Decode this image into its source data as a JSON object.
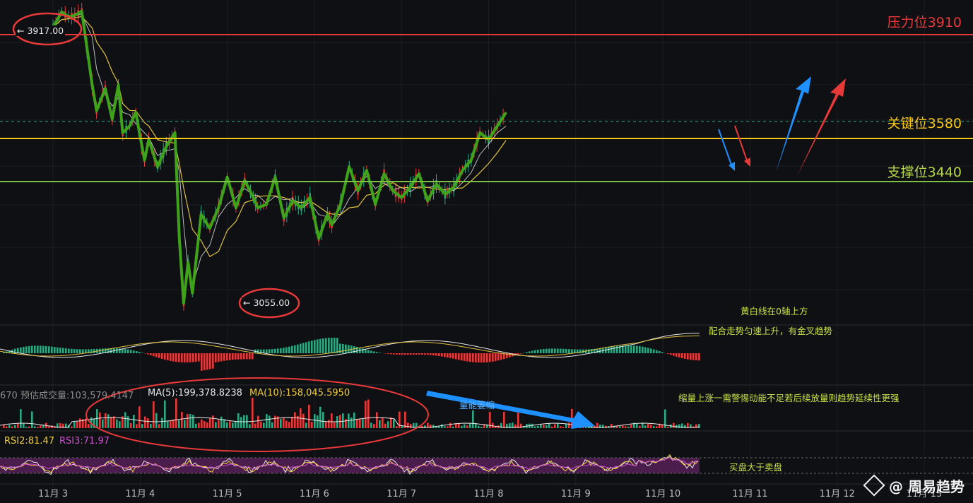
{
  "levels": {
    "resistance": {
      "label": "压力位3910",
      "value": 3910,
      "color": "#e8393a"
    },
    "key": {
      "label": "关键位3580",
      "value": 3580,
      "color": "#f5c518"
    },
    "support": {
      "label": "支撑位3440",
      "value": 3440,
      "color": "#7dc242"
    }
  },
  "annotations": {
    "high": "← 3917.00",
    "low": "← 3055.00"
  },
  "notes": {
    "macd_1": "黄白线在0轴上方",
    "macd_2": "配合走势匀速上升，有金叉趋势",
    "volume": "缩量上涨一需警惕动能不足若后续放量则趋势延续性更强",
    "volume_arrow": "量能萎缩",
    "rsi": "买盘大于卖盘"
  },
  "volume_stats": {
    "est": "670  预估成交量:103,579.4147",
    "ma5": "MA(5):199,378.8238",
    "ma10": "MA(10):158,045.5950"
  },
  "rsi_stats": {
    "rsi2": "RSI2:81.47",
    "rsi3": "RSI3:71.97"
  },
  "watermark": "周易趋势",
  "colors": {
    "up": "#2ea884",
    "down": "#e8393a",
    "trend": "#3fa31a",
    "ma_fast": "#e6e6e6",
    "ma_slow": "#e0c040",
    "arrow_blue": "#1e90ff",
    "arrow_red": "#e8393a"
  },
  "chart_data": {
    "type": "line",
    "title": "",
    "x_ticks": [
      "11月 3",
      "11月 4",
      "11月 5",
      "11月 6",
      "11月 7",
      "11月 8",
      "11月 9",
      "11月 10",
      "11月 11",
      "11月 12",
      "11月 13"
    ],
    "price_range": [
      3000,
      3950
    ],
    "trend_points": {
      "x": [
        0,
        0.1,
        0.18,
        0.25,
        0.33,
        0.45,
        0.5,
        0.6,
        0.68,
        0.75,
        0.8,
        0.88,
        0.95,
        1.05,
        1.1,
        1.2,
        1.3,
        1.4,
        1.45,
        1.5,
        1.55,
        1.6,
        1.7,
        1.8,
        1.9,
        2.0,
        2.1,
        2.2,
        2.3,
        2.35,
        2.45,
        2.55,
        2.65,
        2.75,
        2.85,
        2.95,
        3.05,
        3.15,
        3.2,
        3.3,
        3.4,
        3.5,
        3.6,
        3.7,
        3.8,
        3.9,
        4.0,
        4.1,
        4.2,
        4.3,
        4.4,
        4.5,
        4.55,
        4.6,
        4.7,
        4.8,
        4.9,
        5.0,
        5.1,
        5.2,
        5.3,
        5.4,
        5.5,
        5.6,
        5.7,
        5.8,
        5.9,
        6.0,
        6.1,
        6.2,
        6.3,
        6.4,
        6.45
      ],
      "price": [
        3870,
        3915,
        3900,
        3905,
        3917,
        3700,
        3625,
        3690,
        3600,
        3700,
        3560,
        3580,
        3620,
        3480,
        3540,
        3460,
        3520,
        3560,
        3250,
        3060,
        3180,
        3090,
        3320,
        3280,
        3340,
        3430,
        3340,
        3420,
        3370,
        3340,
        3350,
        3430,
        3310,
        3360,
        3340,
        3370,
        3250,
        3320,
        3290,
        3350,
        3460,
        3390,
        3450,
        3350,
        3440,
        3390,
        3370,
        3400,
        3440,
        3360,
        3410,
        3380,
        3390,
        3400,
        3450,
        3480,
        3560,
        3540,
        3580,
        3620
      ],
      "price_note": "estimated from the trend polyline"
    },
    "levels": [
      3910,
      3580,
      3440
    ]
  }
}
